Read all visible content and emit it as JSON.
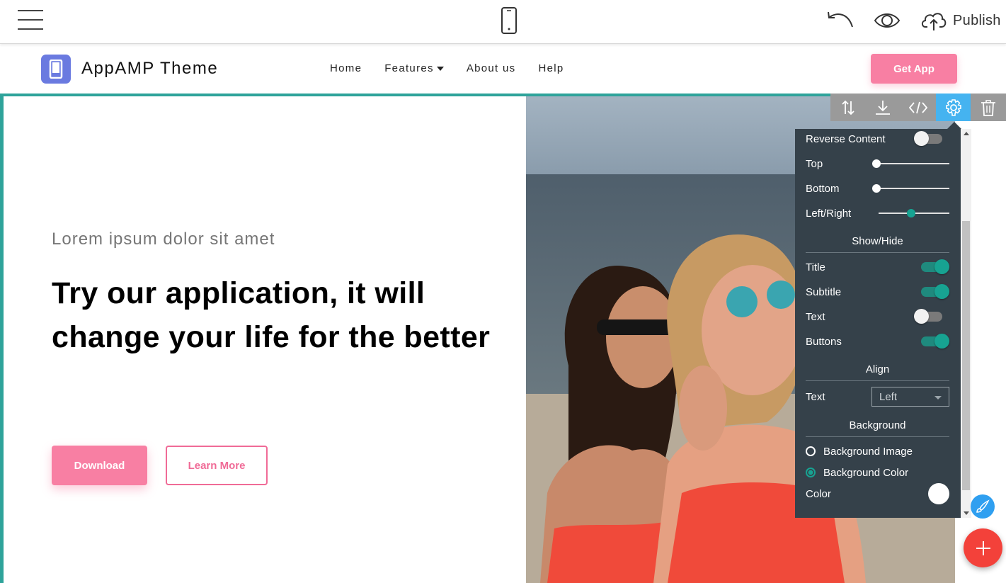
{
  "builder": {
    "publish_label": "Publish"
  },
  "navbar": {
    "brand": "AppAMP Theme",
    "links": [
      "Home",
      "Features",
      "About us",
      "Help"
    ],
    "cta": "Get App"
  },
  "hero": {
    "subtitle": "Lorem ipsum dolor sit amet",
    "title": "Try our application, it will change your life for the better",
    "primary_button": "Download",
    "secondary_button": "Learn More"
  },
  "block_toolbar": {
    "icons": [
      "move-icon",
      "download-icon",
      "code-icon",
      "gear-icon",
      "trash-icon"
    ],
    "active": "gear-icon"
  },
  "settings": {
    "reverse_content": {
      "label": "Reverse Content",
      "on": false
    },
    "sliders": [
      {
        "label": "Top",
        "value": 0
      },
      {
        "label": "Bottom",
        "value": 0
      },
      {
        "label": "Left/Right",
        "value": 0.46
      }
    ],
    "show_hide_heading": "Show/Hide",
    "toggles": [
      {
        "label": "Title",
        "on": true
      },
      {
        "label": "Subtitle",
        "on": true
      },
      {
        "label": "Text",
        "on": false
      },
      {
        "label": "Buttons",
        "on": true
      }
    ],
    "align_heading": "Align",
    "align_text_label": "Text",
    "align_text_value": "Left",
    "background_heading": "Background",
    "background_options": [
      {
        "label": "Background Image",
        "selected": false
      },
      {
        "label": "Background Color",
        "selected": true
      }
    ],
    "color_label": "Color",
    "color_value": "#ffffff"
  },
  "colors": {
    "accent_pink": "#f87fa3",
    "section_border": "#2ea39a",
    "panel_bg": "#35414a",
    "toggle_on": "#17a392",
    "toolbar_active": "#45b3f0",
    "fab_add": "#f3413a",
    "fab_edit": "#2f9ff0",
    "logo": "#6a7ae0"
  }
}
